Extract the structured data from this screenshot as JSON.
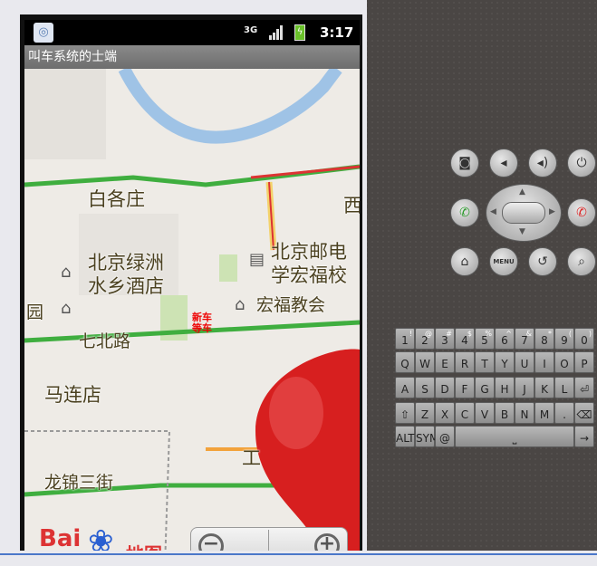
{
  "status_bar": {
    "network": "3G",
    "time": "3:17"
  },
  "app": {
    "title": "叫车系统的士端"
  },
  "map": {
    "labels": {
      "baigezhuang": "白各庄",
      "lvzhou": "北京绿洲",
      "shuixiang": "水乡酒店",
      "youdian": "北京邮电",
      "hongfu_school": "学宏福校",
      "hongfu_church": "宏福教会",
      "yuan": "园",
      "qibei": "七北路",
      "malian": "马连店",
      "xi": "西",
      "longjin": "龙锦三街",
      "gong": "工"
    },
    "marker_text": {
      "line1": "新车",
      "line2": "等车"
    },
    "logo": {
      "brand": "Bai",
      "map_word": "地图"
    }
  },
  "keyboard": {
    "row1": [
      {
        "key": "1",
        "alt": "!"
      },
      {
        "key": "2",
        "alt": "@"
      },
      {
        "key": "3",
        "alt": "#"
      },
      {
        "key": "4",
        "alt": "$"
      },
      {
        "key": "5",
        "alt": "%"
      },
      {
        "key": "6",
        "alt": "^"
      },
      {
        "key": "7",
        "alt": "&"
      },
      {
        "key": "8",
        "alt": "*"
      },
      {
        "key": "9",
        "alt": "("
      },
      {
        "key": "0",
        "alt": ")"
      }
    ],
    "row2": [
      "Q",
      "W",
      "E",
      "R",
      "T",
      "Y",
      "U",
      "I",
      "O",
      "P"
    ],
    "row3": [
      "A",
      "S",
      "D",
      "F",
      "G",
      "H",
      "J",
      "K",
      "L"
    ],
    "row4": [
      "Z",
      "X",
      "C",
      "V",
      "B",
      "N",
      "M"
    ],
    "row5": {
      "alt": "ALT",
      "sym": "SYM",
      "at": "@"
    }
  },
  "controls": {
    "menu_label": "MENU"
  }
}
